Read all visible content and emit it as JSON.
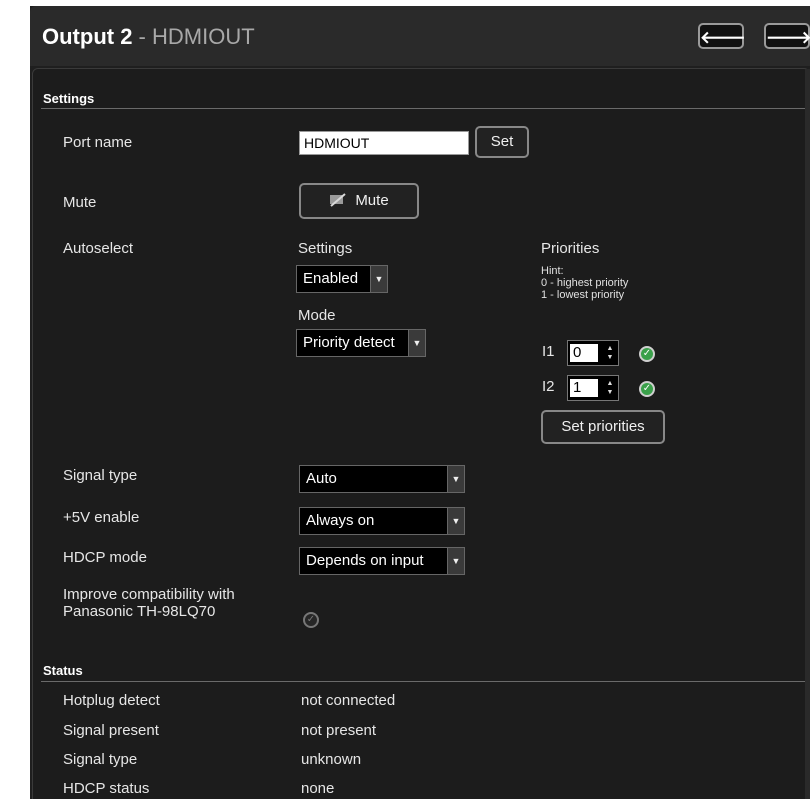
{
  "header": {
    "title_bold": "Output 2",
    "title_sep": " - ",
    "title_port": "HDMIOUT",
    "prev_icon": "arrow-left-icon",
    "next_icon": "arrow-right-icon",
    "prev_glyph": "🡐",
    "next_glyph": "🡒"
  },
  "settings": {
    "section_label": "Settings",
    "port_name": {
      "label": "Port name",
      "value": "HDMIOUT",
      "set_label": "Set"
    },
    "mute": {
      "label": "Mute",
      "button_label": "Mute",
      "icon": "mute-icon"
    },
    "autoselect": {
      "label": "Autoselect",
      "settings_label": "Settings",
      "settings_value": "Enabled",
      "mode_label": "Mode",
      "mode_value": "Priority detect",
      "priorities_label": "Priorities",
      "hint_title": "Hint:",
      "hint_line1": "0 - highest priority",
      "hint_line2": "1 - lowest priority",
      "inputs": [
        {
          "label": "I1",
          "value": "0",
          "check": "check-icon"
        },
        {
          "label": "I2",
          "value": "1",
          "check": "check-icon"
        }
      ],
      "set_priorities_label": "Set priorities"
    },
    "signal_type": {
      "label": "Signal type",
      "value": "Auto"
    },
    "five_v": {
      "label": "+5V enable",
      "value": "Always on"
    },
    "hdcp_mode": {
      "label": "HDCP mode",
      "value": "Depends on input"
    },
    "improve": {
      "label_line1": "Improve compatibility with",
      "label_line2": "Panasonic TH-98LQ70",
      "checked": false
    }
  },
  "status": {
    "section_label": "Status",
    "rows": [
      {
        "label": "Hotplug detect",
        "value": "not connected"
      },
      {
        "label": "Signal present",
        "value": "not present"
      },
      {
        "label": "Signal type",
        "value": "unknown"
      },
      {
        "label": "HDCP status",
        "value": "none"
      }
    ]
  },
  "colors": {
    "background": "#1c1c1c",
    "check_on": "#3aa04a",
    "text": "#e6e6e6"
  }
}
